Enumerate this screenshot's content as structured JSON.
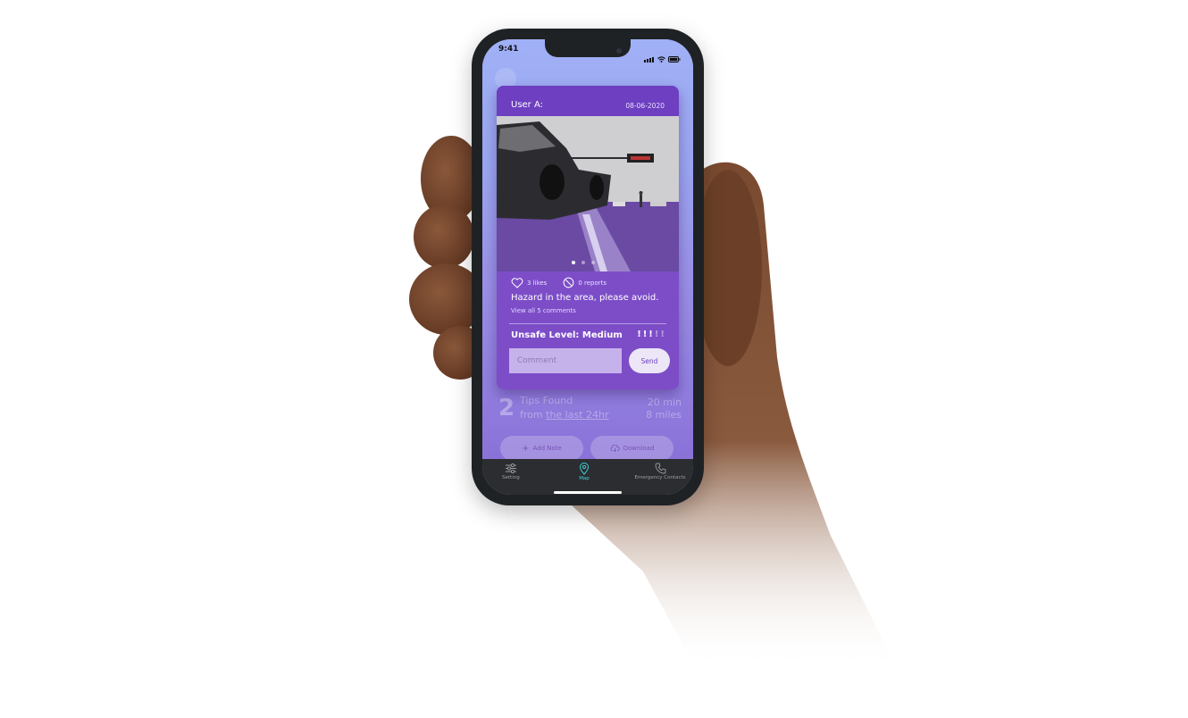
{
  "status_bar": {
    "time": "9:41"
  },
  "card": {
    "user": "User A:",
    "date": "08-06-2020",
    "likes": "3 likes",
    "reports": "0 reports",
    "caption": "Hazard in the area, please avoid.",
    "view_comments": "View all 5 comments",
    "unsafe_level": "Unsafe Level: Medium",
    "unsafe_marks_on": "!!!",
    "unsafe_marks_off": "!!",
    "unsafe_level_value": 3,
    "unsafe_level_max": 5,
    "comment_placeholder": "Comment",
    "send_label": "Send"
  },
  "tips": {
    "count": "2",
    "label": "Tips Found",
    "from": "from",
    "timeframe": "the last 24hr",
    "duration": "20 min",
    "distance": "8 miles"
  },
  "actions": {
    "add_note": "Add Note",
    "download": "Download"
  },
  "tabbar": {
    "items": [
      {
        "label": "Setting",
        "icon": "sliders-icon"
      },
      {
        "label": "Map",
        "icon": "map-pin-icon"
      },
      {
        "label": "Emergency Contacts",
        "icon": "phone-icon"
      }
    ],
    "active": "Map"
  },
  "colors": {
    "card_bg": "#7d4dc8",
    "card_header": "#6e3fc0",
    "tab_active": "#3fd1d9",
    "tabbar_bg": "#2b2d30"
  }
}
